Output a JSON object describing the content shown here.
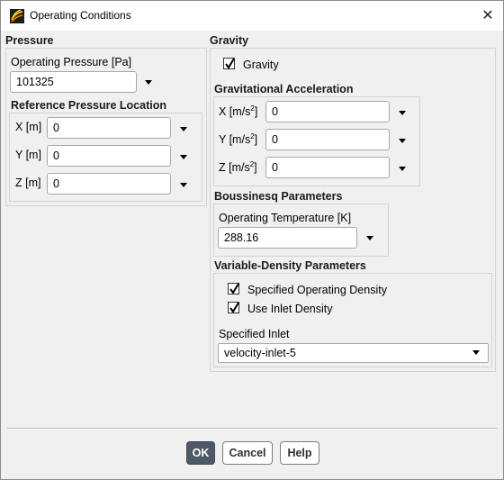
{
  "window": {
    "title": "Operating Conditions",
    "close_glyph": "✕"
  },
  "pressure": {
    "section_title": "Pressure",
    "operating_pressure_label": "Operating Pressure [Pa]",
    "operating_pressure_value": "101325",
    "ref_location_title": "Reference Pressure Location",
    "x_label": "X [m]",
    "x_value": "0",
    "y_label": "Y [m]",
    "y_value": "0",
    "z_label": "Z [m]",
    "z_value": "0"
  },
  "gravity": {
    "section_title": "Gravity",
    "checkbox_label": "Gravity",
    "checked": true,
    "accel_title": "Gravitational Acceleration",
    "x_label": "X [m/s",
    "x_value": "0",
    "y_label": "Y [m/s",
    "y_value": "0",
    "z_label": "Z [m/s",
    "z_value": "0",
    "exp": "2",
    "close_bracket": "]"
  },
  "boussinesq": {
    "section_title": "Boussinesq Parameters",
    "temp_label": "Operating Temperature [K]",
    "temp_value": "288.16"
  },
  "variable_density": {
    "section_title": "Variable-Density Parameters",
    "specified_density_label": "Specified Operating Density",
    "specified_density_checked": true,
    "inlet_density_label": "Use Inlet Density",
    "inlet_density_checked": true,
    "specified_inlet_label": "Specified Inlet",
    "specified_inlet_value": "velocity-inlet-5"
  },
  "buttons": {
    "ok": "OK",
    "cancel": "Cancel",
    "help": "Help"
  },
  "icons": {
    "app": "fluent-app-icon",
    "close": "close-icon",
    "dropdown": "caret-down-icon",
    "check": "checkmark-icon"
  },
  "colors": {
    "primary_button": "#4d5a66",
    "panel": "#f0f0f0"
  }
}
